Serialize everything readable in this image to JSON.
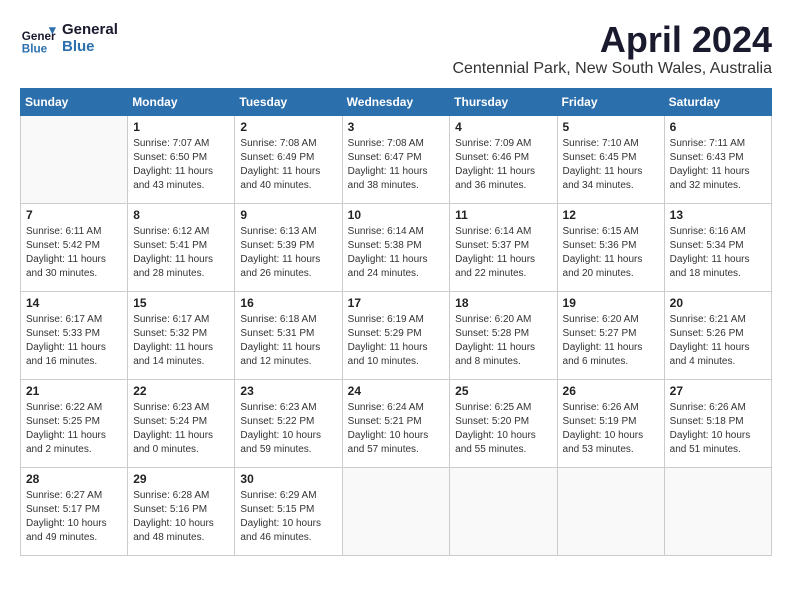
{
  "header": {
    "logo_line1": "General",
    "logo_line2": "Blue",
    "month": "April 2024",
    "location": "Centennial Park, New South Wales, Australia"
  },
  "days_of_week": [
    "Sunday",
    "Monday",
    "Tuesday",
    "Wednesday",
    "Thursday",
    "Friday",
    "Saturday"
  ],
  "weeks": [
    [
      {
        "day": null,
        "sunrise": null,
        "sunset": null,
        "daylight": null
      },
      {
        "day": 1,
        "sunrise": "7:07 AM",
        "sunset": "6:50 PM",
        "daylight": "11 hours and 43 minutes."
      },
      {
        "day": 2,
        "sunrise": "7:08 AM",
        "sunset": "6:49 PM",
        "daylight": "11 hours and 40 minutes."
      },
      {
        "day": 3,
        "sunrise": "7:08 AM",
        "sunset": "6:47 PM",
        "daylight": "11 hours and 38 minutes."
      },
      {
        "day": 4,
        "sunrise": "7:09 AM",
        "sunset": "6:46 PM",
        "daylight": "11 hours and 36 minutes."
      },
      {
        "day": 5,
        "sunrise": "7:10 AM",
        "sunset": "6:45 PM",
        "daylight": "11 hours and 34 minutes."
      },
      {
        "day": 6,
        "sunrise": "7:11 AM",
        "sunset": "6:43 PM",
        "daylight": "11 hours and 32 minutes."
      }
    ],
    [
      {
        "day": 7,
        "sunrise": "6:11 AM",
        "sunset": "5:42 PM",
        "daylight": "11 hours and 30 minutes."
      },
      {
        "day": 8,
        "sunrise": "6:12 AM",
        "sunset": "5:41 PM",
        "daylight": "11 hours and 28 minutes."
      },
      {
        "day": 9,
        "sunrise": "6:13 AM",
        "sunset": "5:39 PM",
        "daylight": "11 hours and 26 minutes."
      },
      {
        "day": 10,
        "sunrise": "6:14 AM",
        "sunset": "5:38 PM",
        "daylight": "11 hours and 24 minutes."
      },
      {
        "day": 11,
        "sunrise": "6:14 AM",
        "sunset": "5:37 PM",
        "daylight": "11 hours and 22 minutes."
      },
      {
        "day": 12,
        "sunrise": "6:15 AM",
        "sunset": "5:36 PM",
        "daylight": "11 hours and 20 minutes."
      },
      {
        "day": 13,
        "sunrise": "6:16 AM",
        "sunset": "5:34 PM",
        "daylight": "11 hours and 18 minutes."
      }
    ],
    [
      {
        "day": 14,
        "sunrise": "6:17 AM",
        "sunset": "5:33 PM",
        "daylight": "11 hours and 16 minutes."
      },
      {
        "day": 15,
        "sunrise": "6:17 AM",
        "sunset": "5:32 PM",
        "daylight": "11 hours and 14 minutes."
      },
      {
        "day": 16,
        "sunrise": "6:18 AM",
        "sunset": "5:31 PM",
        "daylight": "11 hours and 12 minutes."
      },
      {
        "day": 17,
        "sunrise": "6:19 AM",
        "sunset": "5:29 PM",
        "daylight": "11 hours and 10 minutes."
      },
      {
        "day": 18,
        "sunrise": "6:20 AM",
        "sunset": "5:28 PM",
        "daylight": "11 hours and 8 minutes."
      },
      {
        "day": 19,
        "sunrise": "6:20 AM",
        "sunset": "5:27 PM",
        "daylight": "11 hours and 6 minutes."
      },
      {
        "day": 20,
        "sunrise": "6:21 AM",
        "sunset": "5:26 PM",
        "daylight": "11 hours and 4 minutes."
      }
    ],
    [
      {
        "day": 21,
        "sunrise": "6:22 AM",
        "sunset": "5:25 PM",
        "daylight": "11 hours and 2 minutes."
      },
      {
        "day": 22,
        "sunrise": "6:23 AM",
        "sunset": "5:24 PM",
        "daylight": "11 hours and 0 minutes."
      },
      {
        "day": 23,
        "sunrise": "6:23 AM",
        "sunset": "5:22 PM",
        "daylight": "10 hours and 59 minutes."
      },
      {
        "day": 24,
        "sunrise": "6:24 AM",
        "sunset": "5:21 PM",
        "daylight": "10 hours and 57 minutes."
      },
      {
        "day": 25,
        "sunrise": "6:25 AM",
        "sunset": "5:20 PM",
        "daylight": "10 hours and 55 minutes."
      },
      {
        "day": 26,
        "sunrise": "6:26 AM",
        "sunset": "5:19 PM",
        "daylight": "10 hours and 53 minutes."
      },
      {
        "day": 27,
        "sunrise": "6:26 AM",
        "sunset": "5:18 PM",
        "daylight": "10 hours and 51 minutes."
      }
    ],
    [
      {
        "day": 28,
        "sunrise": "6:27 AM",
        "sunset": "5:17 PM",
        "daylight": "10 hours and 49 minutes."
      },
      {
        "day": 29,
        "sunrise": "6:28 AM",
        "sunset": "5:16 PM",
        "daylight": "10 hours and 48 minutes."
      },
      {
        "day": 30,
        "sunrise": "6:29 AM",
        "sunset": "5:15 PM",
        "daylight": "10 hours and 46 minutes."
      },
      {
        "day": null,
        "sunrise": null,
        "sunset": null,
        "daylight": null
      },
      {
        "day": null,
        "sunrise": null,
        "sunset": null,
        "daylight": null
      },
      {
        "day": null,
        "sunrise": null,
        "sunset": null,
        "daylight": null
      },
      {
        "day": null,
        "sunrise": null,
        "sunset": null,
        "daylight": null
      }
    ]
  ]
}
